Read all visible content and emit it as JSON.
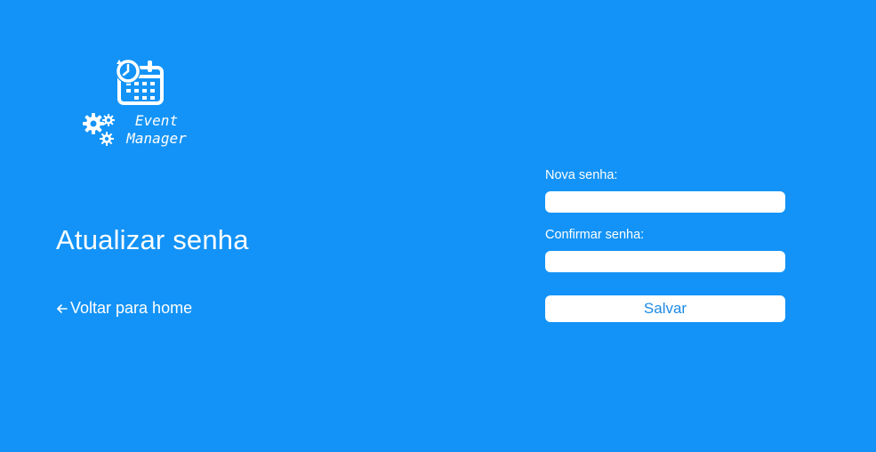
{
  "logo": {
    "line1": "Event",
    "line2": "Manager",
    "calendar_icon": "calendar-clock-icon",
    "gears_icon": "gears-icon"
  },
  "page": {
    "title": "Atualizar senha"
  },
  "nav": {
    "back_label": "Voltar para home",
    "back_icon": "arrow-left-icon"
  },
  "form": {
    "new_password_label": "Nova senha:",
    "new_password_value": "",
    "confirm_password_label": "Confirmar senha:",
    "confirm_password_value": "",
    "save_label": "Salvar"
  },
  "colors": {
    "background": "#1393f7",
    "text": "#ffffff",
    "button_text": "#1d8ae6"
  }
}
